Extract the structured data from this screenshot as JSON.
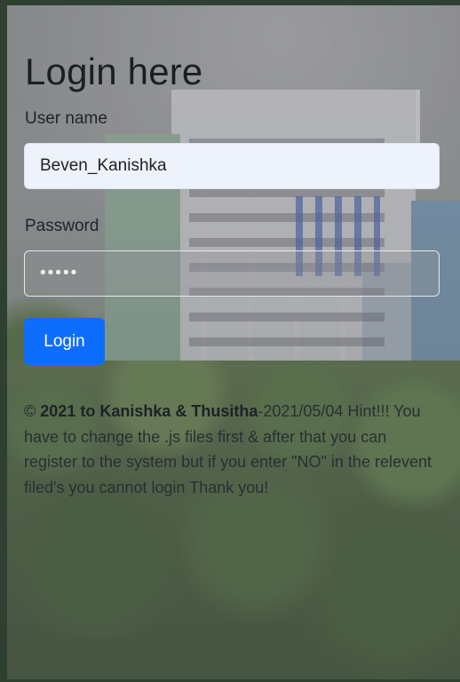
{
  "login": {
    "title": "Login here",
    "username_label": "User name",
    "username_value": "Beven_Kanishka",
    "password_label": "Password",
    "password_value": "•••••",
    "submit_label": "Login"
  },
  "footer": {
    "copyright_symbol": "©",
    "copyright_text": "2021 to Kanishka & Thusitha",
    "date": "-2021/05/04",
    "hint": "Hint!!! You have to change the .js files first & after that you can register to the system but if you enter \"NO\" in the relevent filed's you cannot login Thank you!"
  },
  "colors": {
    "primary_button": "#0d6efd",
    "input_background": "#eef2fb"
  }
}
